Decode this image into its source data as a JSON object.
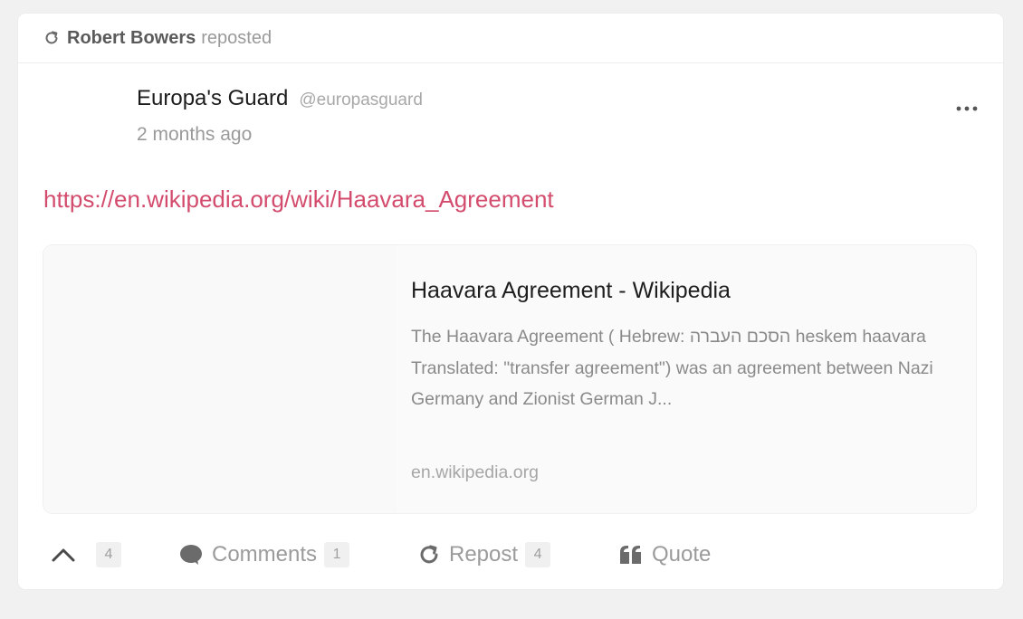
{
  "repost": {
    "icon": "repost-icon",
    "user": "Robert Bowers",
    "label": "reposted"
  },
  "post": {
    "author_name": "Europa's Guard",
    "author_handle": "@europasguard",
    "time": "2 months ago",
    "more_icon": "more-horizontal-icon",
    "link": "https://en.wikipedia.org/wiki/Haavara_Agreement",
    "link_color": "#d34b6d"
  },
  "preview": {
    "title": "Haavara Agreement - Wikipedia",
    "description": "The Haavara Agreement ( Hebrew: הסכם העברה heskem haavara Translated: \"transfer agreement\") was an agreement between Nazi Germany and Zionist German J...",
    "domain": "en.wikipedia.org"
  },
  "actions": {
    "upvote": {
      "icon": "chevron-up-icon",
      "count": "4"
    },
    "comments": {
      "icon": "comment-bubble-icon",
      "label": "Comments",
      "count": "1"
    },
    "repost": {
      "icon": "repost-icon",
      "label": "Repost",
      "count": "4"
    },
    "quote": {
      "icon": "quote-icon",
      "label": "Quote"
    }
  }
}
